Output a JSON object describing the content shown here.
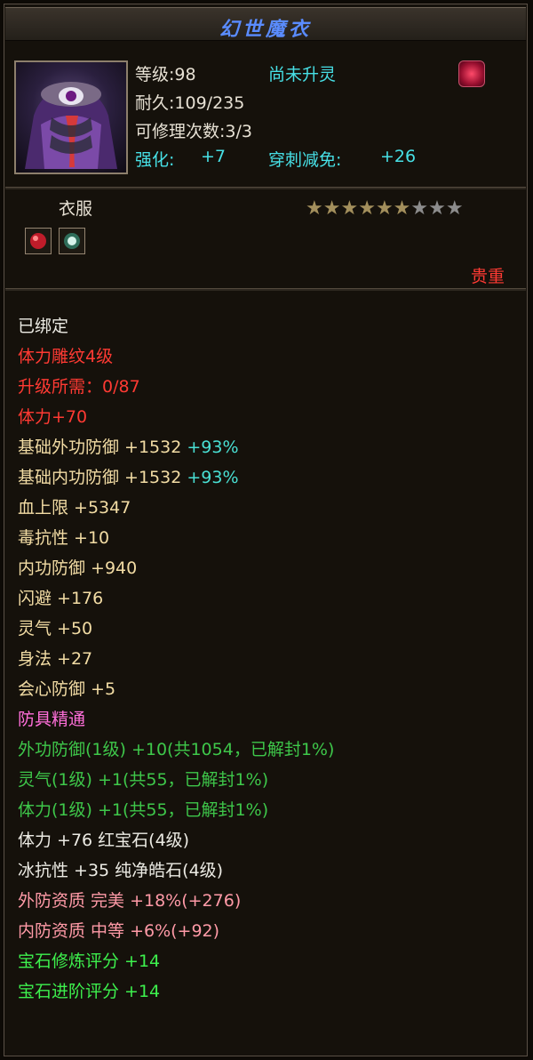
{
  "item": {
    "name": "幻世魔衣",
    "level_text": "等级:98",
    "spirit_status": "尚未升灵",
    "durability_text": "耐久:109/235",
    "repair_text": "可修理次数:3/3",
    "enhance_label": "强化:",
    "enhance_value": "+7",
    "pierce_label": "穿刺减免:",
    "pierce_value": "+26",
    "type": "衣服",
    "rarity": "贵重",
    "stars_total": 9,
    "stars_filled": 6,
    "stars_value": "6/9"
  },
  "attributes": [
    {
      "text": "已绑定",
      "cls": "white"
    },
    {
      "text": "体力雕纹4级",
      "cls": "red"
    },
    {
      "text": "升级所需：0/87",
      "cls": "red"
    },
    {
      "text": "体力+70",
      "cls": "red"
    },
    {
      "text": "基础外功防御 +1532 ",
      "cls": "gold",
      "extra": "+93%",
      "extra_cls": "teal"
    },
    {
      "text": "基础内功防御 +1532 ",
      "cls": "gold",
      "extra": "+93%",
      "extra_cls": "teal"
    },
    {
      "text": "血上限 +5347",
      "cls": "gold"
    },
    {
      "text": "毒抗性 +10",
      "cls": "gold"
    },
    {
      "text": "内功防御 +940",
      "cls": "gold"
    },
    {
      "text": "闪避 +176",
      "cls": "gold"
    },
    {
      "text": "灵气 +50",
      "cls": "gold"
    },
    {
      "text": "身法 +27",
      "cls": "gold"
    },
    {
      "text": "会心防御 +5",
      "cls": "gold"
    },
    {
      "text": "防具精通",
      "cls": "pink"
    },
    {
      "text": "外功防御(1级) +10(共1054，已解封1%)",
      "cls": "green"
    },
    {
      "text": "灵气(1级) +1(共55，已解封1%)",
      "cls": "green"
    },
    {
      "text": "体力(1级) +1(共55，已解封1%)",
      "cls": "green"
    },
    {
      "text": "体力 +76 红宝石(4级)",
      "cls": "white"
    },
    {
      "text": "冰抗性 +35 纯净皓石(4级)",
      "cls": "white"
    },
    {
      "text": "外防资质  完美 +18%(+276)",
      "cls": "peach"
    },
    {
      "text": "内防资质  中等 +6%(+92)",
      "cls": "peach"
    },
    {
      "text": "宝石修炼评分 +14",
      "cls": "bright-green"
    },
    {
      "text": "宝石进阶评分 +14",
      "cls": "bright-green"
    }
  ],
  "icons": {
    "rune": "rune-icon",
    "gem_slot_1": "red-gem-icon",
    "gem_slot_2": "white-gem-icon",
    "portrait": "armor-portrait-icon"
  }
}
